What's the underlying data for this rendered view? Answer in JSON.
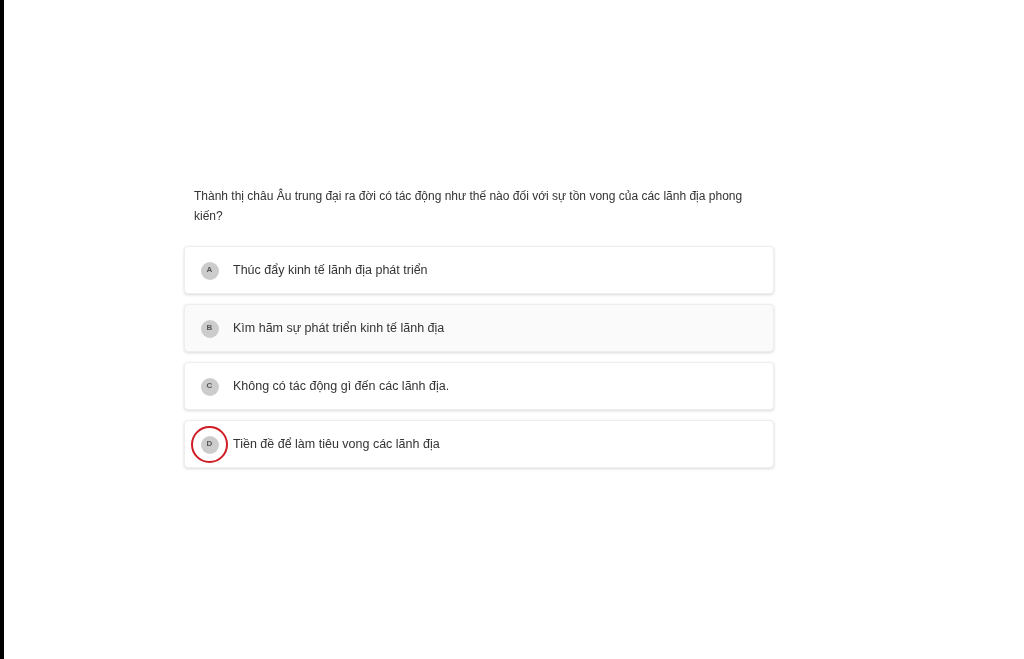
{
  "question": "Thành thị châu Âu trung đại ra đời có tác động như thế nào đối với sự tồn vong của các lãnh địa phong kiến?",
  "options": [
    {
      "letter": "A",
      "text": "Thúc đẩy kinh tế lãnh địa phát triển",
      "selected": false
    },
    {
      "letter": "B",
      "text": "Kìm hãm sự phát triển kinh tế lãnh địa",
      "selected": false
    },
    {
      "letter": "C",
      "text": "Không có tác động gì đến các lãnh địa.",
      "selected": false
    },
    {
      "letter": "D",
      "text": "Tiền đề để làm tiêu vong các lãnh địa",
      "selected": true
    }
  ]
}
